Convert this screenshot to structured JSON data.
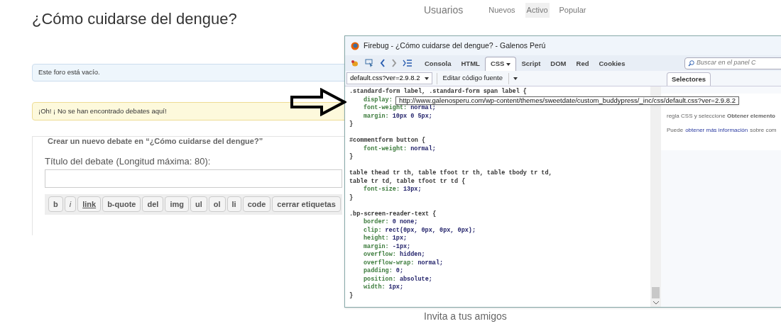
{
  "page": {
    "title": "¿Cómo cuidarse del dengue?",
    "info_notice": "Este foro está vacío.",
    "warning_notice": "¡Oh! ¡ No se han encontrado debates aquí!",
    "form": {
      "legend": "Crear un nuevo debate en “¿Cómo cuidarse del dengue?”",
      "title_label": "Título del debate (Longitud máxima: 80):",
      "editor_buttons": [
        {
          "label": "b",
          "kind": "bold"
        },
        {
          "label": "i",
          "kind": "italic"
        },
        {
          "label": "link",
          "kind": "link"
        },
        {
          "label": "b-quote",
          "kind": "tag"
        },
        {
          "label": "del",
          "kind": "tag"
        },
        {
          "label": "img",
          "kind": "tag"
        },
        {
          "label": "ul",
          "kind": "tag"
        },
        {
          "label": "ol",
          "kind": "tag"
        },
        {
          "label": "li",
          "kind": "tag"
        },
        {
          "label": "code",
          "kind": "tag"
        },
        {
          "label": "cerrar etiquetas",
          "kind": "tag"
        }
      ]
    }
  },
  "sidebar": {
    "heading": "Usuarios",
    "filters": [
      {
        "label": "Nuevos",
        "selected": false
      },
      {
        "label": "Activo",
        "selected": true
      },
      {
        "label": "Popular",
        "selected": false
      }
    ],
    "invite": "Invita a tus amigos"
  },
  "firebug": {
    "title": "Firebug - ¿Cómo cuidarse del dengue? - Galenos Perú",
    "tabs": [
      {
        "label": "Consola",
        "selected": false,
        "menu": false
      },
      {
        "label": "HTML",
        "selected": false,
        "menu": false
      },
      {
        "label": "CSS",
        "selected": true,
        "menu": true
      },
      {
        "label": "Script",
        "selected": false,
        "menu": false
      },
      {
        "label": "DOM",
        "selected": false,
        "menu": false
      },
      {
        "label": "Red",
        "selected": false,
        "menu": false
      },
      {
        "label": "Cookies",
        "selected": false,
        "menu": false
      }
    ],
    "search_placeholder": "Buscar en el panel C",
    "file_select": "default.css?ver=2.9.8.2",
    "edit_source": "Editar código fuente",
    "rules": [
      {
        "selector": [
          ".standard-form label, .standard-form span label {"
        ],
        "declarations": [
          {
            "property": "display:"
          },
          {
            "property": "font-weight:",
            "value": "normal;"
          },
          {
            "property": "margin:",
            "value": "10px 0 5px;"
          }
        ],
        "close": "}"
      },
      {
        "selector": [
          "#commentform button {"
        ],
        "declarations": [
          {
            "property": "font-weight:",
            "value": "normal;"
          }
        ],
        "close": "}"
      },
      {
        "selector": [
          "table thead tr th, table tfoot tr th, table tbody tr td,",
          "table tr td, table tfoot tr td {"
        ],
        "declarations": [
          {
            "property": "font-size:",
            "value": "13px;"
          }
        ],
        "close": "}"
      },
      {
        "selector": [
          ".bp-screen-reader-text {"
        ],
        "declarations": [
          {
            "property": "border:",
            "value": "0 none;"
          },
          {
            "property": "clip:",
            "value": "rect(0px, 0px, 0px, 0px);"
          },
          {
            "property": "height:",
            "value": "1px;"
          },
          {
            "property": "margin:",
            "value": "-1px;"
          },
          {
            "property": "overflow:",
            "value": "hidden;"
          },
          {
            "property": "overflow-wrap:",
            "value": "normal;"
          },
          {
            "property": "padding:",
            "value": "0;"
          },
          {
            "property": "position:",
            "value": "absolute;"
          },
          {
            "property": "width:",
            "value": "1px;"
          }
        ],
        "close": "}"
      }
    ],
    "side_tab": {
      "label": "Selectores",
      "selected": true
    },
    "side_lines": [
      "regla CSS y seleccione **Obtener elemento**"
    ],
    "side_more": {
      "before": "Puede",
      "link": "obtener más información",
      "after": "sobre com"
    },
    "tooltip": "http://www.galenosperu.com/wp-content/themes/sweetdate/custom_buddypress/_inc/css/default.css?ver=2.9.8.2"
  }
}
